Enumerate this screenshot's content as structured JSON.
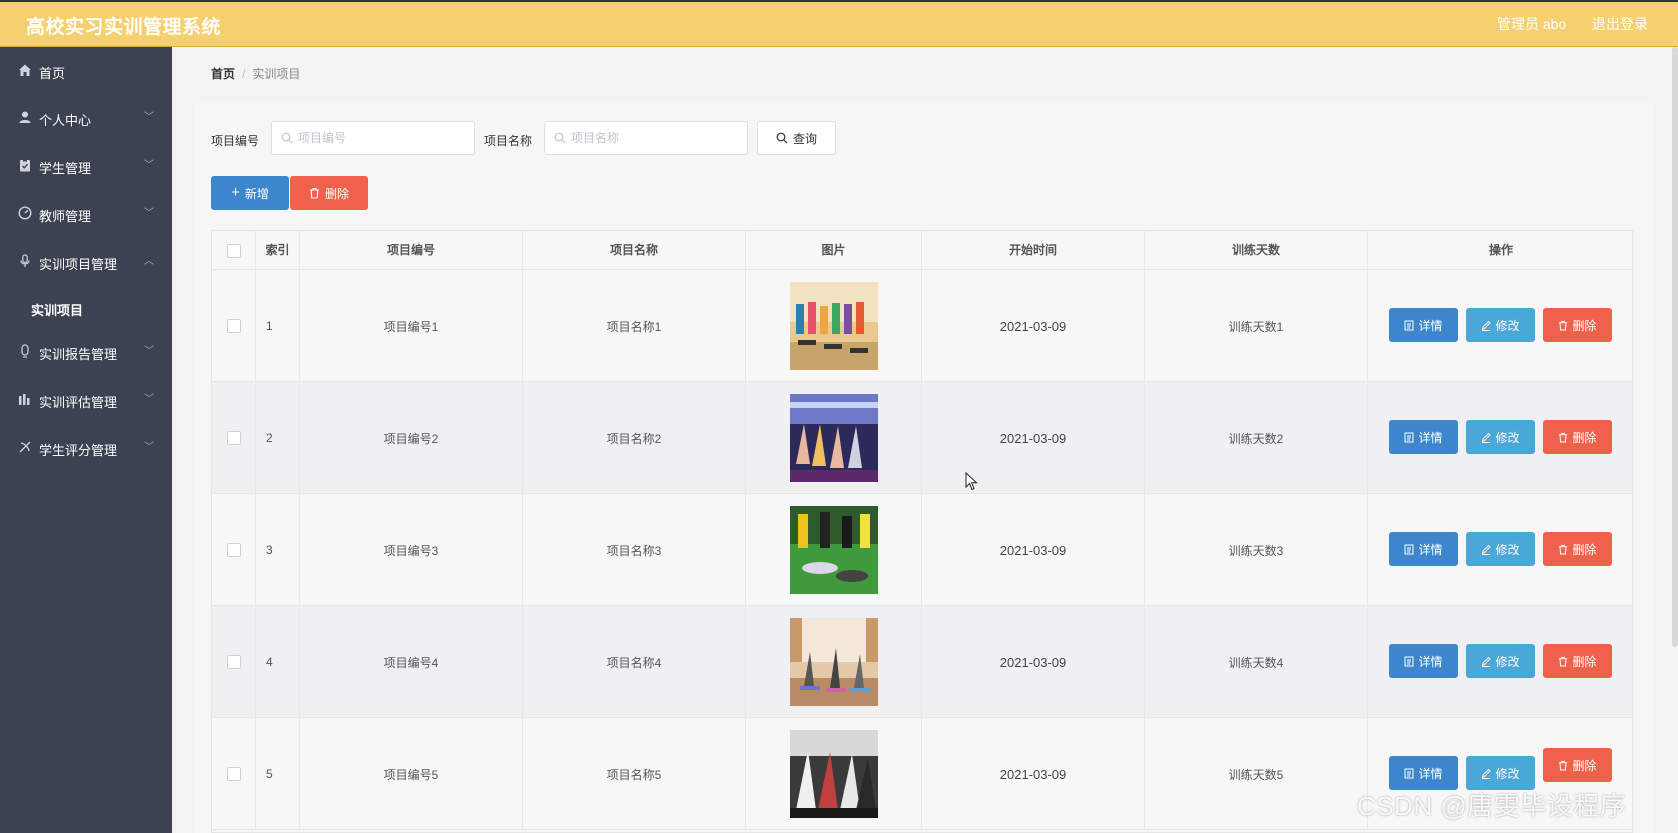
{
  "header": {
    "title": "高校实习实训管理系统",
    "user": "管理员 abo",
    "logout": "退出登录"
  },
  "sidebar": {
    "items": [
      {
        "label": "首页",
        "icon": "home-icon",
        "arrow": ""
      },
      {
        "label": "个人中心",
        "icon": "user-icon",
        "arrow": "﹀"
      },
      {
        "label": "学生管理",
        "icon": "clipboard-icon",
        "arrow": "﹀"
      },
      {
        "label": "教师管理",
        "icon": "gauge-icon",
        "arrow": "﹀"
      },
      {
        "label": "实训项目管理",
        "icon": "mic-icon",
        "arrow": "︿"
      },
      {
        "label": "实训报告管理",
        "icon": "report-icon",
        "arrow": "﹀"
      },
      {
        "label": "实训评估管理",
        "icon": "chart-icon",
        "arrow": "﹀"
      },
      {
        "label": "学生评分管理",
        "icon": "rating-icon",
        "arrow": "﹀"
      }
    ],
    "sub_item": "实训项目"
  },
  "breadcrumb": {
    "home": "首页",
    "separator": "/",
    "current": "实训项目"
  },
  "search": {
    "code_label": "项目编号",
    "code_placeholder": "项目编号",
    "name_label": "项目名称",
    "name_placeholder": "项目名称",
    "query_button": "查询"
  },
  "actions": {
    "add_button": "新增",
    "delete_button": "删除"
  },
  "table": {
    "headers": [
      "索引",
      "项目编号",
      "项目名称",
      "图片",
      "开始时间",
      "训练天数",
      "操作"
    ],
    "rows": [
      {
        "index": "1",
        "code": "项目编号1",
        "name": "项目名称1",
        "start": "2021-03-09",
        "days": "训练天数1",
        "image": "fitness-class-photo"
      },
      {
        "index": "2",
        "code": "项目编号2",
        "name": "项目名称2",
        "start": "2021-03-09",
        "days": "训练天数2",
        "image": "gym-training-photo"
      },
      {
        "index": "3",
        "code": "项目编号3",
        "name": "项目名称3",
        "start": "2021-03-09",
        "days": "训练天数3",
        "image": "stretching-class-photo"
      },
      {
        "index": "4",
        "code": "项目编号4",
        "name": "项目名称4",
        "start": "2021-03-09",
        "days": "训练天数4",
        "image": "yoga-class-photo"
      },
      {
        "index": "5",
        "code": "项目编号5",
        "name": "项目名称5",
        "start": "2021-03-09",
        "days": "训练天数5",
        "image": "step-aerobics-photo"
      }
    ],
    "row_actions": {
      "detail": "详情",
      "edit": "修改",
      "delete": "删除"
    }
  },
  "watermark": "CSDN @唐雯毕设程序",
  "colors": {
    "header_bg": "#f6cf6f",
    "sidebar_bg": "#3c4252",
    "primary": "#3d86ce",
    "info": "#4aa8d8",
    "danger": "#f0614c"
  }
}
